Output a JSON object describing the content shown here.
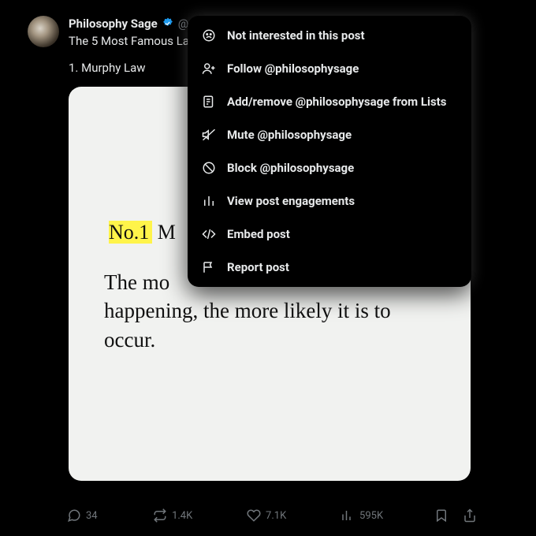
{
  "post": {
    "display_name": "Philosophy Sage",
    "text_line1": "The 5 Most Famous La",
    "text_line2": "1. Murphy Law",
    "card": {
      "label_highlight": "No.1",
      "label_rest": "M",
      "body_prefix": "The mo",
      "body_rest": "happening, the more likely it is to occur."
    }
  },
  "actions": {
    "reply_count": "34",
    "repost_count": "1.4K",
    "like_count": "7.1K",
    "view_count": "595K"
  },
  "menu": {
    "items": [
      {
        "icon": "frown-icon",
        "label": "Not interested in this post"
      },
      {
        "icon": "user-plus-icon",
        "label": "Follow @philosophysage"
      },
      {
        "icon": "list-icon",
        "label": "Add/remove @philosophysage from Lists"
      },
      {
        "icon": "mute-icon",
        "label": "Mute @philosophysage"
      },
      {
        "icon": "block-icon",
        "label": "Block @philosophysage"
      },
      {
        "icon": "analytics-icon",
        "label": "View post engagements"
      },
      {
        "icon": "embed-icon",
        "label": "Embed post"
      },
      {
        "icon": "flag-icon",
        "label": "Report post"
      }
    ]
  }
}
